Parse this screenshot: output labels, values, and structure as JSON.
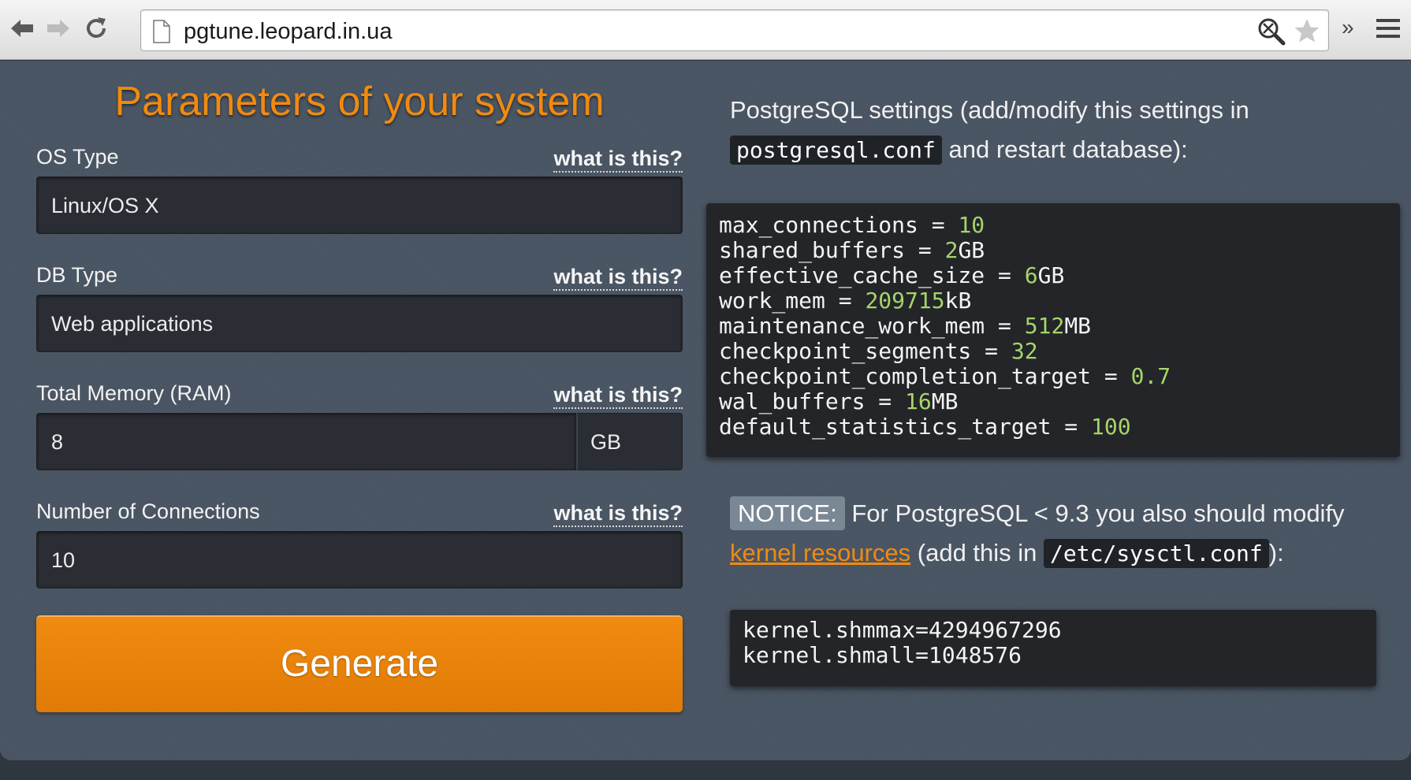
{
  "browser": {
    "url": "pgtune.leopard.in.ua",
    "overflow_label": "»"
  },
  "form": {
    "title": "Parameters of your system",
    "what_label": "what is this?",
    "os_type": {
      "label": "OS Type",
      "value": "Linux/OS X"
    },
    "db_type": {
      "label": "DB Type",
      "value": "Web applications"
    },
    "memory": {
      "label": "Total Memory (RAM)",
      "value": "8",
      "unit": "GB"
    },
    "connections": {
      "label": "Number of Connections",
      "value": "10"
    },
    "generate_label": "Generate"
  },
  "output": {
    "intro_text": "PostgreSQL settings (add/modify this settings in",
    "intro_code": "postgresql.conf",
    "intro_suffix": " and restart database):",
    "settings": [
      {
        "key": "max_connections = ",
        "value": "10",
        "unit": ""
      },
      {
        "key": "shared_buffers = ",
        "value": "2",
        "unit": "GB"
      },
      {
        "key": "effective_cache_size = ",
        "value": "6",
        "unit": "GB"
      },
      {
        "key": "work_mem = ",
        "value": "209715",
        "unit": "kB"
      },
      {
        "key": "maintenance_work_mem = ",
        "value": "512",
        "unit": "MB"
      },
      {
        "key": "checkpoint_segments = ",
        "value": "32",
        "unit": ""
      },
      {
        "key": "checkpoint_completion_target = ",
        "value": "0.7",
        "unit": ""
      },
      {
        "key": "wal_buffers = ",
        "value": "16",
        "unit": "MB"
      },
      {
        "key": "default_statistics_target = ",
        "value": "100",
        "unit": ""
      }
    ],
    "notice_badge": "NOTICE:",
    "notice_text": " For PostgreSQL < 9.3 you also should modify ",
    "notice_link": "kernel resources",
    "notice_mid": " (add this in ",
    "notice_code": "/etc/sysctl.conf",
    "notice_end": "):",
    "kernel_lines": [
      "kernel.shmmax=4294967296",
      "kernel.shmall=1048576"
    ]
  }
}
